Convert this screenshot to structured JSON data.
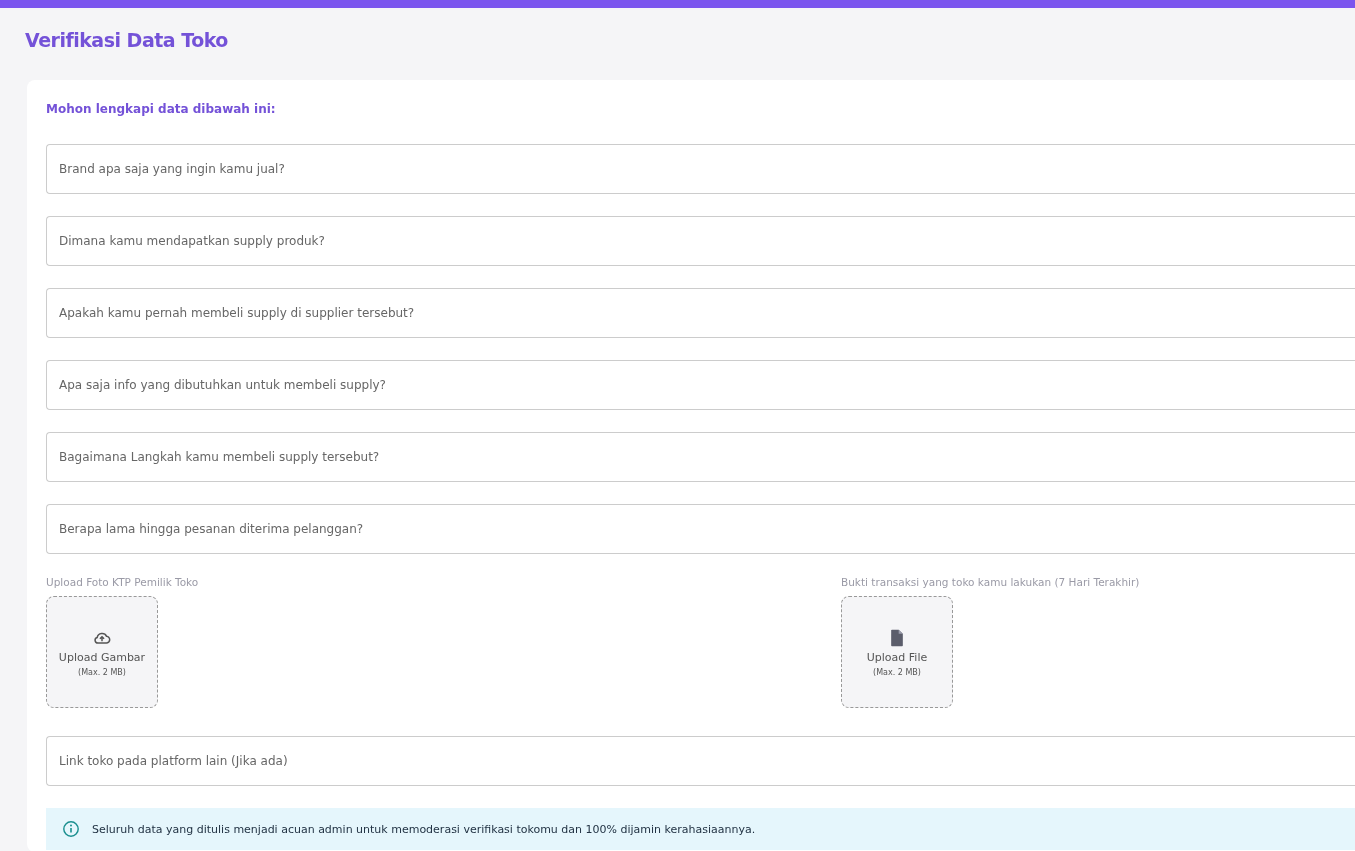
{
  "title": "Verifikasi Data Toko",
  "intro": "Mohon lengkapi data dibawah ini:",
  "questions": [
    {
      "placeholder": "Brand apa saja yang ingin kamu jual?"
    },
    {
      "placeholder": "Dimana kamu mendapatkan supply produk?"
    },
    {
      "placeholder": "Apakah kamu pernah membeli supply di supplier tersebut?"
    },
    {
      "placeholder": "Apa saja info yang dibutuhkan untuk membeli supply?"
    },
    {
      "placeholder": "Bagaimana Langkah kamu membeli supply tersebut?"
    },
    {
      "placeholder": "Berapa lama hingga pesanan diterima pelanggan?"
    }
  ],
  "uploads": [
    {
      "kind": "image",
      "label": "Upload Foto KTP Pemilik Toko",
      "button": "Upload Gambar",
      "limit": "(Max. 2 MB)"
    },
    {
      "kind": "file",
      "label": "Bukti transaksi yang toko kamu lakukan (7 Hari Terakhir)",
      "button": "Upload File",
      "limit": "(Max. 2 MB)"
    }
  ],
  "link_field": {
    "placeholder": "Link toko pada platform lain (Jika ada)"
  },
  "notice": "Seluruh data yang ditulis menjadi acuan admin untuk memoderasi verifikasi tokomu dan 100% dijamin kerahasiaannya."
}
